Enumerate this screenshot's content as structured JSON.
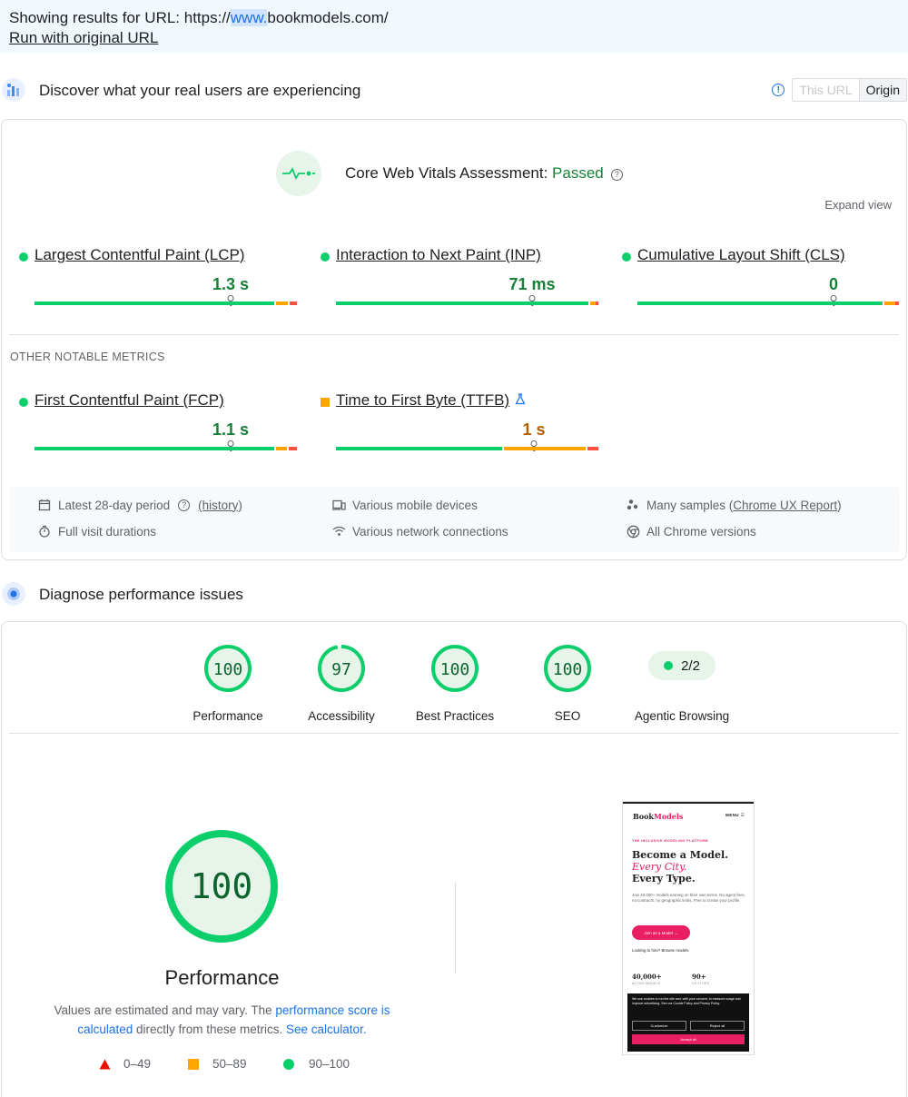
{
  "url_banner": {
    "prefix": "Showing results for URL: https://",
    "highlight": "www.",
    "suffix": "bookmodels.com/",
    "run_original": "Run with original URL"
  },
  "field": {
    "title": "Discover what your real users are experiencing",
    "toggle": {
      "this_url": "This URL",
      "origin": "Origin"
    },
    "assessment_label": "Core Web Vitals Assessment: ",
    "assessment_status": "Passed",
    "expand_view": "Expand view",
    "metrics": [
      {
        "name": "Largest Contentful Paint (LCP)",
        "value": "1.3 s",
        "marker_fraction": 0.75,
        "status": "good"
      },
      {
        "name": "Interaction to Next Paint (INP)",
        "value": "71 ms",
        "marker_fraction": 0.75,
        "status": "good"
      },
      {
        "name": "Cumulative Layout Shift (CLS)",
        "value": "0",
        "marker_fraction": 0.75,
        "status": "good"
      }
    ],
    "other_label": "OTHER NOTABLE METRICS",
    "other_metrics": [
      {
        "name": "First Contentful Paint (FCP)",
        "value": "1.1 s",
        "marker_fraction": 0.75,
        "status": "good"
      },
      {
        "name": "Time to First Byte (TTFB)",
        "value": "1 s",
        "marker_fraction": 0.75,
        "status": "average"
      }
    ],
    "info": {
      "period": "Latest 28-day period",
      "history": "(history)",
      "durations": "Full visit durations",
      "devices": "Various mobile devices",
      "network": "Various network connections",
      "samples_prefix": "Many samples (",
      "samples_link": "Chrome UX Report",
      "samples_suffix": ")",
      "chrome": "All Chrome versions"
    }
  },
  "lab": {
    "title": "Diagnose performance issues",
    "scores": [
      {
        "label": "Performance",
        "score": "100",
        "value": 100
      },
      {
        "label": "Accessibility",
        "score": "97",
        "value": 97
      },
      {
        "label": "Best Practices",
        "score": "100",
        "value": 100
      },
      {
        "label": "SEO",
        "score": "100",
        "value": 100
      }
    ],
    "agentic": {
      "label": "Agentic Browsing",
      "value": "2/2"
    },
    "big_score": "100",
    "big_score_value": 100,
    "big_label": "Performance",
    "note": {
      "part1": "Values are estimated and may vary. The ",
      "link1": "performance score is calculated",
      "part2": " directly from these metrics. ",
      "link2": "See calculator."
    },
    "legend": {
      "poor": "0–49",
      "average": "50–89",
      "good": "90–100"
    },
    "colors": {
      "good": "#0cce6b",
      "average": "#ffa400",
      "poor": "#ff4e42"
    }
  },
  "screenshot": {
    "brand_a": "Book",
    "brand_b": "Models",
    "menu": "MENU",
    "tag": "THE INCLUSIVE MODELING PLATFORM",
    "line1": "Become a Model.",
    "line2": "Every City.",
    "line3": "Every Type.",
    "desc": "Join 40,000+ models earning on their own terms. No agent fees, no contracts, no geographic limits. Free to create your profile.",
    "cta": "Join as a Model →",
    "hire": "Looking to hire? Browse models",
    "stat1": "40,000+",
    "stat1_sub": "ACTIVE MODELS",
    "stat2": "90+",
    "stat2_sub": "US CITIES",
    "cookie_text": "We use cookies to run the site and, with your consent, to measure usage and improve advertising. See our Cookie Policy and Privacy Policy.",
    "customize": "Customize",
    "reject": "Reject all",
    "accept": "Accept all"
  }
}
